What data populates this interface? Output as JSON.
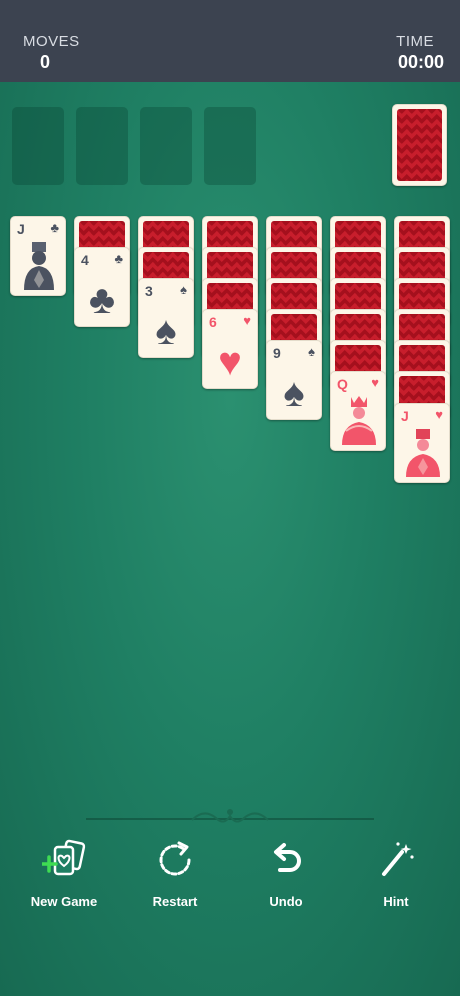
{
  "header": {
    "moves_label": "MOVES",
    "moves_value": "0",
    "time_label": "TIME",
    "time_value": "00:00"
  },
  "tableau": {
    "col1": {
      "rank": "J",
      "suit": "♣"
    },
    "col2": {
      "rank": "4",
      "suit": "♣"
    },
    "col3": {
      "rank": "3",
      "suit": "♠"
    },
    "col4": {
      "rank": "6",
      "suit": "♥"
    },
    "col5": {
      "rank": "9",
      "suit": "♠"
    },
    "col6": {
      "rank": "Q",
      "suit": "♥"
    },
    "col7": {
      "rank": "J",
      "suit": "♥"
    }
  },
  "toolbar": {
    "new_game": "New Game",
    "restart": "Restart",
    "undo": "Undo",
    "hint": "Hint"
  },
  "colors": {
    "felt": "#1f7f63",
    "topbar": "#3c4350",
    "card_back": "#c81e2c",
    "red_suit": "#f2556a",
    "black_suit": "#4b5260"
  }
}
